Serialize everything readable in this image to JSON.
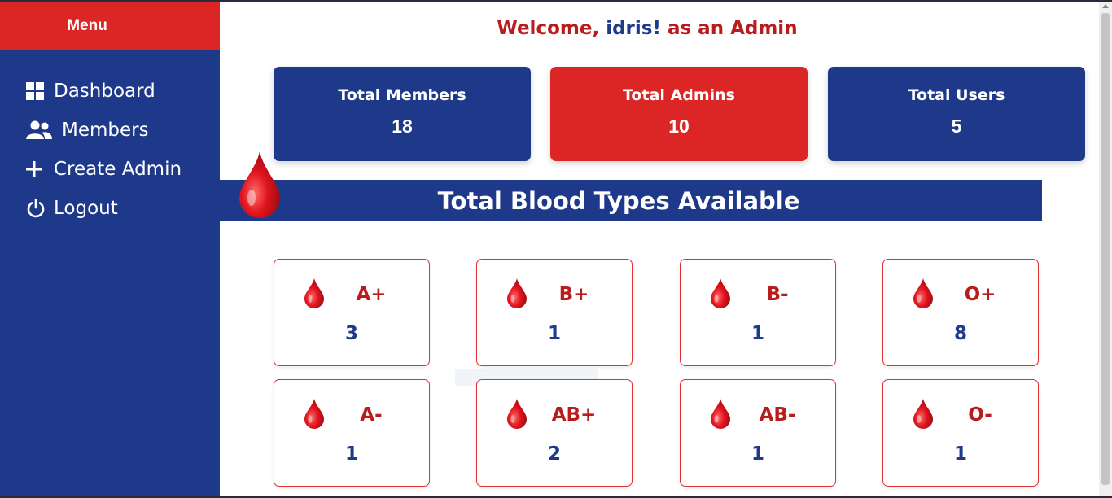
{
  "sidebar": {
    "title": "Menu",
    "items": [
      {
        "label": "Dashboard",
        "icon": "grid-icon"
      },
      {
        "label": "Members",
        "icon": "users-icon"
      },
      {
        "label": "Create Admin",
        "icon": "plus-icon"
      },
      {
        "label": "Logout",
        "icon": "power-icon"
      }
    ]
  },
  "welcome": {
    "prefix": "Welcome, ",
    "name": "idris!",
    "suffix": " as an Admin"
  },
  "stats": [
    {
      "label": "Total Members",
      "value": "18",
      "color": "#1e398a"
    },
    {
      "label": "Total Admins",
      "value": "10",
      "color": "#dc2626"
    },
    {
      "label": "Total Users",
      "value": "5",
      "color": "#1e398a"
    }
  ],
  "banner": {
    "title": "Total Blood Types Available"
  },
  "blood_types": [
    {
      "type": "A+",
      "count": "3"
    },
    {
      "type": "B+",
      "count": "1"
    },
    {
      "type": "B-",
      "count": "1"
    },
    {
      "type": "O+",
      "count": "8"
    },
    {
      "type": "A-",
      "count": "1"
    },
    {
      "type": "AB+",
      "count": "2"
    },
    {
      "type": "AB-",
      "count": "1"
    },
    {
      "type": "O-",
      "count": "1"
    }
  ],
  "colors": {
    "primary": "#1e398a",
    "accent": "#dc2626",
    "text_red": "#b91c1c",
    "text_blue": "#1e3a8a"
  }
}
